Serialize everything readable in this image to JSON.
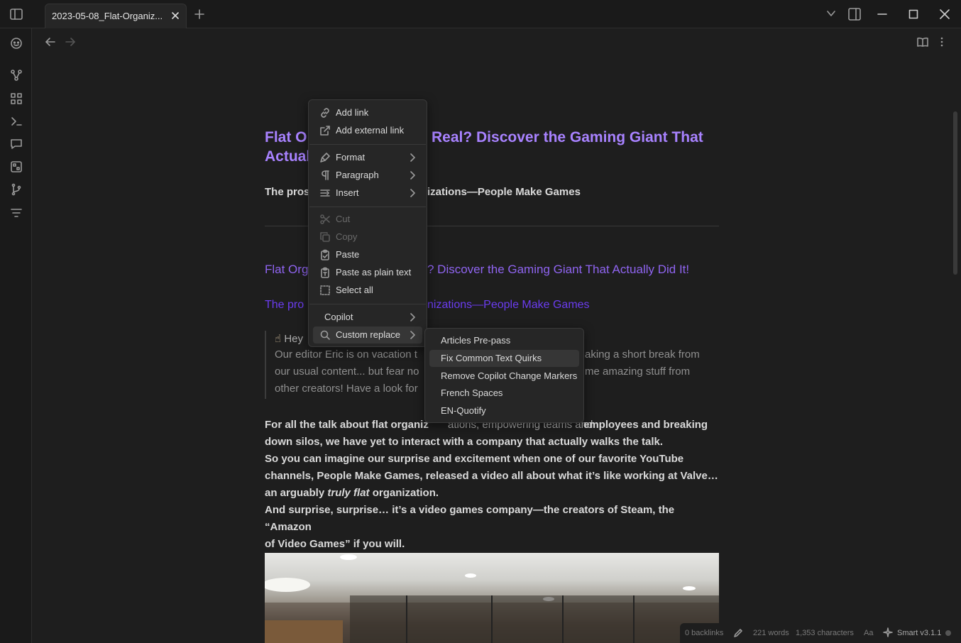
{
  "tab": {
    "title": "2023-05-08_Flat-Organiz..."
  },
  "document": {
    "title": "Flat Organizations: Real? Discover the Gaming Giant That Actually Did It!",
    "title_visible_left_1": "Flat O",
    "title_visible_right_1": "Real? Discover the Gaming Giant That",
    "title_visible_left_2": "Actual",
    "subtitle_left": "The pros",
    "subtitle_right": "izations—People Make Games",
    "link_h2_left": "Flat Org",
    "link_h2_right": "? Discover the Gaming Giant That Actually Did It!",
    "link_h3_left": "The pro",
    "link_h3_right": "nizations—People Make Games",
    "quote_head": "Hey",
    "quote_lines_left": [
      "Our editor Eric is on vacation t",
      "our usual content... but fear no",
      "other creators! Have a look for"
    ],
    "quote_lines_right": [
      "aking a short break from",
      "me amazing stuff from",
      ""
    ],
    "body_line1_left": "For all the talk about flat organiz",
    "body_line1_mid": "ations, empowering teams and",
    "body_line1_right": "employees and breaking",
    "body_line2": "down silos, we have yet to interact with a company that actually walks the talk.",
    "body_line3": "So you can imagine our surprise and excitement when one of our favorite YouTube",
    "body_line4": "channels, People Make Games, released a video all about what it’s like working at Valve…",
    "body_line5_pre": "an arguably ",
    "body_line5_em": "truly flat",
    "body_line5_post": " organization.",
    "body_line6": "And surprise, surprise… it’s a video games company—the creators of Steam, the “Amazon",
    "body_line7": "of Video Games” if you will."
  },
  "context_menu": {
    "add_link": "Add link",
    "add_external_link": "Add external link",
    "format": "Format",
    "paragraph": "Paragraph",
    "insert": "Insert",
    "cut": "Cut",
    "copy": "Copy",
    "paste": "Paste",
    "paste_plain": "Paste as plain text",
    "select_all": "Select all",
    "copilot": "Copilot",
    "custom_replace": "Custom replace"
  },
  "submenu": {
    "items": [
      "Articles Pre-pass",
      "Fix Common Text Quirks",
      "Remove Copilot Change Markers",
      "French Spaces",
      "EN-Quotify"
    ]
  },
  "status_bar": {
    "backlinks": "0 backlinks",
    "word_count": "221 words",
    "char_count": "1,353 characters",
    "font_toggle": "Aa",
    "plugin": "Smart v3.1.1"
  },
  "colors": {
    "accent": "#a882ff",
    "link_h2": "#8f64f0",
    "link_h3": "#6b3cf0",
    "background": "#1e1e1e"
  },
  "icons": [
    "sidebar-toggle-icon",
    "close-icon",
    "plus-icon",
    "chevron-down-icon",
    "split-pane-icon",
    "minimize-icon",
    "maximize-icon",
    "help-icon",
    "graph-icon",
    "dashboard-icon",
    "terminal-icon",
    "chat-icon",
    "canvas-icon",
    "branch-icon",
    "filter-icon",
    "arrow-left-icon",
    "arrow-right-icon",
    "book-icon",
    "more-icon",
    "link-icon",
    "external-link-icon",
    "brush-icon",
    "pilcrow-icon",
    "insert-icon",
    "scissors-icon",
    "copy-icon",
    "clipboard-icon",
    "select-all-icon",
    "search-icon",
    "pencil-icon"
  ]
}
